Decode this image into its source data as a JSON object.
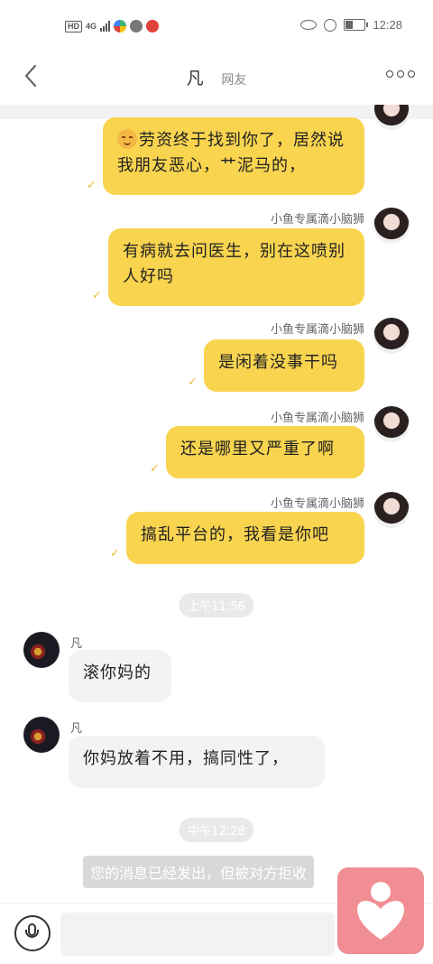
{
  "status_bar": {
    "hd": "HD",
    "network": "4G",
    "time": "12:28",
    "battery_level": 0.4
  },
  "header": {
    "name": "凡",
    "tag": "网友"
  },
  "messages": [
    {
      "id": "m1",
      "side": "right",
      "sender": "",
      "text": "劳资终于找到你了，居然说我朋友恶心，艹泥马的，",
      "has_emoji": true
    },
    {
      "id": "m2",
      "side": "right",
      "sender": "小鱼专属滴小脑狮",
      "text": "有病就去问医生，别在这喷别人好吗"
    },
    {
      "id": "m3",
      "side": "right",
      "sender": "小鱼专属滴小脑狮",
      "text": "是闲着没事干吗"
    },
    {
      "id": "m4",
      "side": "right",
      "sender": "小鱼专属滴小脑狮",
      "text": "还是哪里又严重了啊"
    },
    {
      "id": "m5",
      "side": "right",
      "sender": "小鱼专属滴小脑狮",
      "text": "搞乱平台的，我看是你吧"
    },
    {
      "id": "t1",
      "type": "time",
      "text": "上午11:56"
    },
    {
      "id": "m6",
      "side": "left",
      "sender": "凡",
      "text": "滚你妈的"
    },
    {
      "id": "m7",
      "side": "left",
      "sender": "凡",
      "text": "你妈放着不用，搞同性了，"
    },
    {
      "id": "t2",
      "type": "time",
      "text": "中午12:28"
    },
    {
      "id": "s1",
      "type": "system",
      "text": "您的消息已经发出，但被对方拒收"
    }
  ],
  "icons": {
    "back": "chevron-left-icon",
    "more": "more-icon",
    "mic": "microphone-icon",
    "fab": "heart-icon",
    "read": "check-icon"
  },
  "colors": {
    "outgoing_bubble": "#f8d44f",
    "incoming_bubble": "#f3f3f5",
    "fab": "#f08e93",
    "check": "#e8b930"
  },
  "input": {
    "value": "",
    "placeholder": ""
  }
}
